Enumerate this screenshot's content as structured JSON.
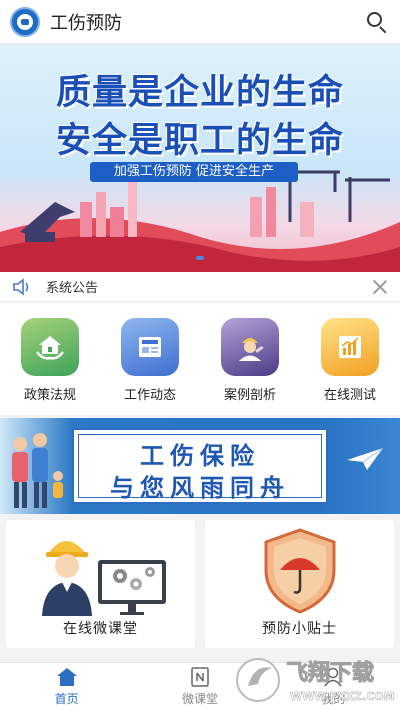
{
  "header": {
    "title": "工伤预防"
  },
  "banner": {
    "line1": "质量是企业的生命",
    "line2": "安全是职工的生命",
    "subtitle": "加强工伤预防  促进安全生产"
  },
  "notice": {
    "label": "系统公告"
  },
  "menu": [
    {
      "label": "政策法规",
      "icon": "house-hands-icon"
    },
    {
      "label": "工作动态",
      "icon": "news-icon"
    },
    {
      "label": "案例剖析",
      "icon": "worker-icon"
    },
    {
      "label": "在线测试",
      "icon": "chart-icon"
    }
  ],
  "banner2": {
    "line1": "工伤保险",
    "line2": "与您风雨同舟"
  },
  "cards": [
    {
      "label": "在线微课堂"
    },
    {
      "label": "预防小贴士"
    }
  ],
  "tabs": [
    {
      "label": "首页",
      "active": true
    },
    {
      "label": "微课堂",
      "active": false
    },
    {
      "label": "我的",
      "active": false
    }
  ],
  "watermark": {
    "brand": "飞翔下载",
    "url": "WWW.FXXZ.COM"
  },
  "colors": {
    "primary": "#2b6ec2",
    "bannerText": "#1a4fb8"
  }
}
